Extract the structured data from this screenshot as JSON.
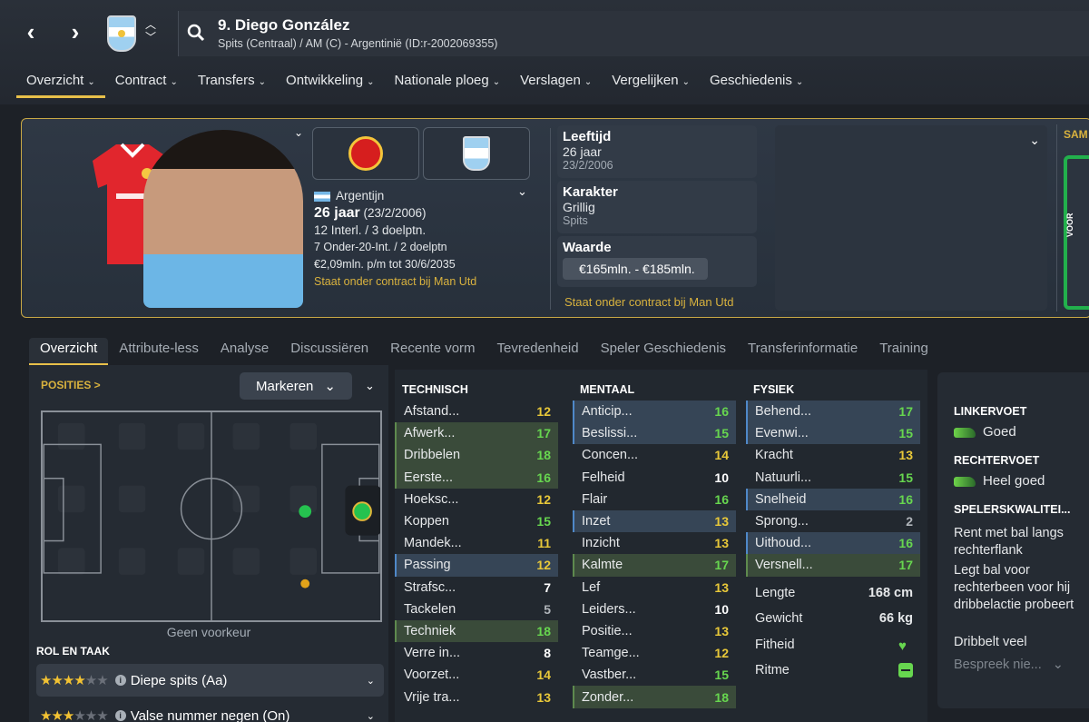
{
  "header": {
    "player_name": "9. Diego González",
    "player_sub": "Spits (Centraal) / AM (C) - Argentinië (ID:r-2002069355)"
  },
  "nav": {
    "tabs": [
      "Overzicht",
      "Contract",
      "Transfers",
      "Ontwikkeling",
      "Nationale ploeg",
      "Verslagen",
      "Vergelijken",
      "Geschiedenis"
    ],
    "active_tab": "Overzicht"
  },
  "profile": {
    "nationality": "Argentijn",
    "age": "26 jaar",
    "dob": "(23/2/2006)",
    "caps": "12 Interl. / 3 doelptn.",
    "youth_caps": "7 Onder-20-Int. / 2 doelptn",
    "wage": "€2,09mln. p/m tot 30/6/2035",
    "contract_status": "Staat onder contract bij Man Utd"
  },
  "details": {
    "age_label": "Leeftijd",
    "age_value": "26 jaar",
    "age_date": "23/2/2006",
    "character_label": "Karakter",
    "character_value": "Grillig",
    "character_sub": "Spits",
    "value_label": "Waarde",
    "value_range": "€165mln. - €185mln.",
    "contract_note": "Staat onder contract bij Man Utd",
    "side_label": "SAM",
    "side_bar_label": "VOOR"
  },
  "subtabs": {
    "items": [
      "Overzicht",
      "Attribute-less",
      "Analyse",
      "Discussiëren",
      "Recente vorm",
      "Tevredenheid",
      "Speler Geschiedenis",
      "Transferinformatie",
      "Training"
    ],
    "active": "Overzicht"
  },
  "positions": {
    "title": "POSITIES >",
    "highlight_button": "Markeren",
    "no_preference": "Geen voorkeur",
    "role_title": "ROL EN TAAK",
    "roles": [
      {
        "stars_on": 4,
        "stars_total": 6,
        "label": "Diepe spits (Aa)"
      },
      {
        "stars_on": 3,
        "stars_total": 6,
        "label": "Valse nummer negen (On)"
      }
    ]
  },
  "attributes": {
    "technical_title": "TECHNISCH",
    "mental_title": "MENTAAL",
    "physical_title": "FYSIEK",
    "technical": [
      {
        "name": "Afstand...",
        "value": 12,
        "hl": ""
      },
      {
        "name": "Afwerk...",
        "value": 17,
        "hl": "g"
      },
      {
        "name": "Dribbelen",
        "value": 18,
        "hl": "g"
      },
      {
        "name": "Eerste...",
        "value": 16,
        "hl": "g"
      },
      {
        "name": "Hoeksc...",
        "value": 12,
        "hl": ""
      },
      {
        "name": "Koppen",
        "value": 15,
        "hl": ""
      },
      {
        "name": "Mandek...",
        "value": 11,
        "hl": ""
      },
      {
        "name": "Passing",
        "value": 12,
        "hl": "b"
      },
      {
        "name": "Strafsc...",
        "value": 7,
        "hl": ""
      },
      {
        "name": "Tackelen",
        "value": 5,
        "hl": ""
      },
      {
        "name": "Techniek",
        "value": 18,
        "hl": "g"
      },
      {
        "name": "Verre in...",
        "value": 8,
        "hl": ""
      },
      {
        "name": "Voorzet...",
        "value": 14,
        "hl": ""
      },
      {
        "name": "Vrije tra...",
        "value": 13,
        "hl": ""
      }
    ],
    "mental": [
      {
        "name": "Anticip...",
        "value": 16,
        "hl": "b"
      },
      {
        "name": "Beslissi...",
        "value": 15,
        "hl": "b"
      },
      {
        "name": "Concen...",
        "value": 14,
        "hl": ""
      },
      {
        "name": "Felheid",
        "value": 10,
        "hl": ""
      },
      {
        "name": "Flair",
        "value": 16,
        "hl": ""
      },
      {
        "name": "Inzet",
        "value": 13,
        "hl": "b"
      },
      {
        "name": "Inzicht",
        "value": 13,
        "hl": ""
      },
      {
        "name": "Kalmte",
        "value": 17,
        "hl": "g"
      },
      {
        "name": "Lef",
        "value": 13,
        "hl": ""
      },
      {
        "name": "Leiders...",
        "value": 10,
        "hl": ""
      },
      {
        "name": "Positie...",
        "value": 13,
        "hl": ""
      },
      {
        "name": "Teamge...",
        "value": 12,
        "hl": ""
      },
      {
        "name": "Vastber...",
        "value": 15,
        "hl": ""
      },
      {
        "name": "Zonder...",
        "value": 18,
        "hl": "g"
      }
    ],
    "physical": [
      {
        "name": "Behend...",
        "value": 17,
        "hl": "b"
      },
      {
        "name": "Evenwi...",
        "value": 15,
        "hl": "b"
      },
      {
        "name": "Kracht",
        "value": 13,
        "hl": ""
      },
      {
        "name": "Natuurli...",
        "value": 15,
        "hl": ""
      },
      {
        "name": "Snelheid",
        "value": 16,
        "hl": "b"
      },
      {
        "name": "Sprong...",
        "value": 2,
        "hl": ""
      },
      {
        "name": "Uithoud...",
        "value": 16,
        "hl": "b"
      },
      {
        "name": "Versnell...",
        "value": 17,
        "hl": "g"
      }
    ],
    "height_label": "Lengte",
    "height_value": "168 cm",
    "weight_label": "Gewicht",
    "weight_value": "66 kg",
    "fitness_label": "Fitheid",
    "rhythm_label": "Ritme"
  },
  "feet": {
    "left_label": "LINKERVOET",
    "left_value": "Goed",
    "right_label": "RECHTERVOET",
    "right_value": "Heel goed",
    "traits_label": "SPELERSKWALITEI...",
    "traits": [
      "Rent met bal langs rechterflank",
      "Legt bal voor rechterbeen voor hij dribbelactie probeert",
      "Dribbelt veel"
    ],
    "discuss": "Bespreek nie..."
  },
  "colors": {
    "accent": "#e8c04a",
    "good": "#67d64f",
    "mid": "#e8c839"
  }
}
